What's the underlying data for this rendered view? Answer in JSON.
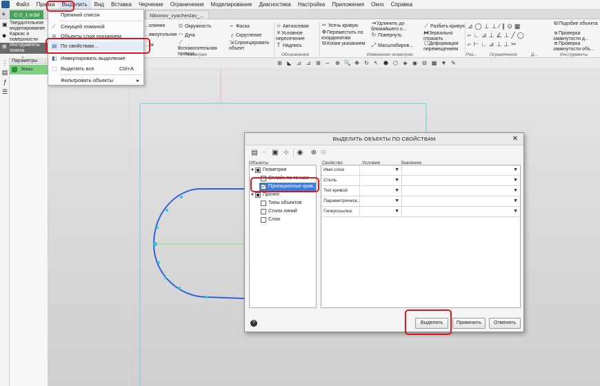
{
  "menubar": {
    "items": [
      "Файл",
      "Правка",
      "Выделить",
      "Вид",
      "Вставка",
      "Черчение",
      "Ограничения",
      "Моделирование",
      "Диагностика",
      "Настройка",
      "Приложения",
      "Окно",
      "Справка"
    ],
    "active": "Выделить"
  },
  "tabs": {
    "doc1": "C-2_1.m3d",
    "doc2": "Nikonov_vyacheslav_..."
  },
  "left_modes": {
    "solid": "Твердотельное моделирование",
    "frame": "Каркас и поверхности",
    "sketch": "Инструменты эскиза"
  },
  "params_panel": {
    "title": "Параметры",
    "item": "Эскиз"
  },
  "select_menu": {
    "items": [
      {
        "label": "Прежний список",
        "icon": "list-icon"
      },
      {
        "label": "Секущей ломаной",
        "icon": "polyline-icon"
      },
      {
        "label": "Объекты слоя указанием",
        "icon": "layer-icon"
      },
      {
        "label": "По свойствам...",
        "icon": "properties-icon"
      },
      {
        "label": "Инвертировать выделение",
        "icon": "invert-icon"
      },
      {
        "label": "Выделить все",
        "shortcut": "Ctrl+A",
        "icon": "select-all-icon"
      },
      {
        "label": "Фильтровать объекты",
        "icon": "filter-icon"
      }
    ]
  },
  "ribbon": {
    "col1": [
      "...олиния",
      "...ямоугольник",
      "...ок"
    ],
    "col2": [
      "Окружность",
      "Дуга",
      "Вспомогательная прямая"
    ],
    "col3": [
      "Фаска",
      "Скругление",
      "Спроецировать объект"
    ],
    "col4": [
      "Автоосевая",
      "Условное пересечение",
      "Надпись"
    ],
    "col5": [
      "Усечь кривую",
      "Переместить по координатам",
      "Копия указанием"
    ],
    "col6": [
      "Удлинить до ближайшего о...",
      "Повернуть",
      "Масштабиров..."
    ],
    "col7": [
      "Разбить кривую",
      "Зеркально отразить",
      "Деформация перемещением"
    ],
    "col8": [
      "Подобие объекта",
      "Проверка замкнутости д...",
      "Проверка замкнутости объ..."
    ],
    "captions": [
      "Геометрия",
      "Обозначения",
      "Изменение геометрии",
      "Раз...",
      "Ограничения",
      "Д...",
      "Инструменты"
    ]
  },
  "dialog": {
    "title": "ВЫДЕЛИТЬ ОБЪЕКТЫ ПО СВОЙСТВАМ",
    "objects_header": "Объекты",
    "tree": [
      {
        "label": "Геометрия",
        "level": 0,
        "state": "partial",
        "expander": "▼"
      },
      {
        "label": "Сплайн по точкам",
        "level": 1,
        "state": "unchecked"
      },
      {
        "label": "Проекционные крив...",
        "level": 1,
        "state": "checked",
        "selected": true
      },
      {
        "label": "Прочее",
        "level": 0,
        "state": "partial",
        "expander": "▼"
      },
      {
        "label": "Типы объектов",
        "level": 1,
        "state": "unchecked"
      },
      {
        "label": "Стили линий",
        "level": 1,
        "state": "unchecked"
      },
      {
        "label": "Слои",
        "level": 1,
        "state": "unchecked"
      }
    ],
    "columns": [
      "Свойство",
      "Условие",
      "Значение"
    ],
    "properties": [
      "Имя слоя",
      "Стиль",
      "Тип кривой",
      "Параметрическ...",
      "Гиперссылка"
    ],
    "buttons": {
      "select": "Выделить",
      "apply": "Применить",
      "cancel": "Отменить"
    },
    "help": "?"
  },
  "colors": {
    "accent_green": "#4aa35a",
    "highlight_red": "#e0141e",
    "curve_blue": "#2f5fd8",
    "frame_cyan": "#5fd3e6"
  }
}
